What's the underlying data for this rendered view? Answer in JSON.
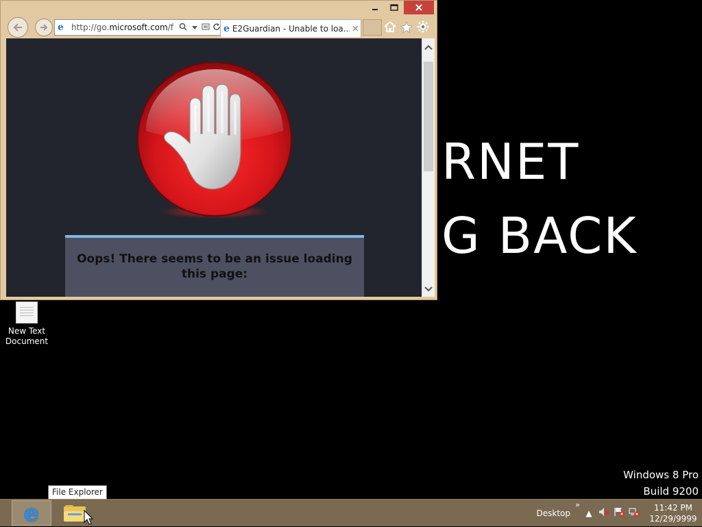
{
  "wallpaper": {
    "line1": "RNET",
    "line2": "G BACK"
  },
  "desktop": {
    "icon_label_line1": "New Text",
    "icon_label_line2": "Document"
  },
  "browser": {
    "address_prefix": "http://go.",
    "address_domain": "microsoft.com",
    "address_suffix": "/f",
    "tab_title": "E2Guardian - Unable to loa...",
    "page_message": "Oops! There seems to be an issue loading this page:",
    "colors": {
      "frame": "#e3c9a1",
      "content_bg": "#22252d",
      "stop_red": "#d4151a",
      "message_box": "#4c5061",
      "message_accent": "#7fb6e0"
    }
  },
  "watermark": {
    "line1": "Windows 8 Pro",
    "line2": "Build 9200"
  },
  "tooltip": {
    "text": "File Explorer"
  },
  "taskbar": {
    "desktop_label": "Desktop",
    "chevron": "»",
    "show_hidden": "▲",
    "time": "11:42 PM",
    "date": "12/29/9999"
  },
  "icons": {
    "back": "back-arrow-icon",
    "forward": "forward-arrow-icon",
    "home": "home-icon",
    "favorites": "star-icon",
    "tools": "gear-icon",
    "stop": "stop-hand-icon"
  }
}
